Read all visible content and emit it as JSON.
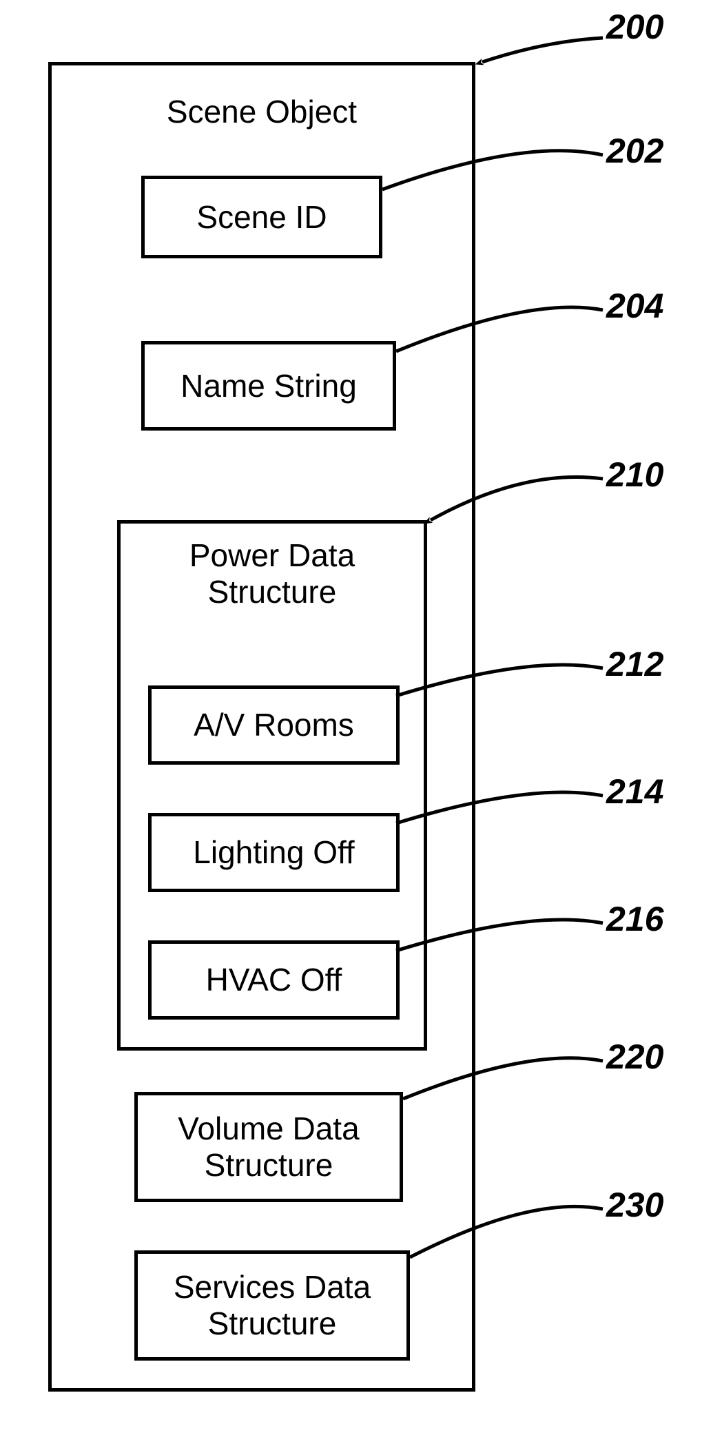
{
  "outer": {
    "title": "Scene Object"
  },
  "scene_id": {
    "label": "Scene ID"
  },
  "name_string": {
    "label": "Name String"
  },
  "power": {
    "title": "Power Data\nStructure",
    "av": "A/V Rooms",
    "lighting": "Lighting Off",
    "hvac": "HVAC Off"
  },
  "volume": {
    "label": "Volume Data\nStructure"
  },
  "services": {
    "label": "Services Data\nStructure"
  },
  "refs": {
    "r200": "200",
    "r202": "202",
    "r204": "204",
    "r210": "210",
    "r212": "212",
    "r214": "214",
    "r216": "216",
    "r220": "220",
    "r230": "230"
  }
}
